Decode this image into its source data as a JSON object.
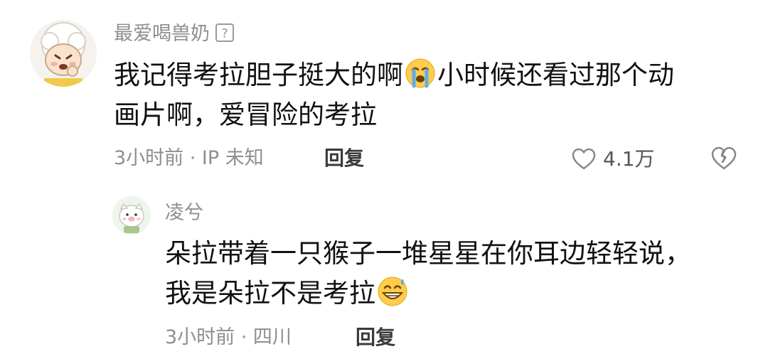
{
  "comment": {
    "username": "最爱喝兽奶",
    "badge_icon": "question-box-icon",
    "text_part1": "我记得考拉胆子挺大的啊",
    "emoji": "crying-face-emoji",
    "text_part2": "小时候还看过那个动",
    "text_line2": "画片啊，爱冒险的考拉",
    "meta": "3小时前 · IP 未知",
    "reply_label": "回复",
    "like_count": "4.1万",
    "like_icon": "heart-outline-icon",
    "dislike_icon": "broken-heart-icon"
  },
  "reply": {
    "username": "凌兮",
    "text_line1": "朵拉带着一只猴子一堆星星在你耳边轻轻说，",
    "text_line2": "我是朵拉不是考拉",
    "emoji": "grinning-sweat-emoji",
    "meta": "3小时前 · 四川",
    "reply_label": "回复"
  }
}
